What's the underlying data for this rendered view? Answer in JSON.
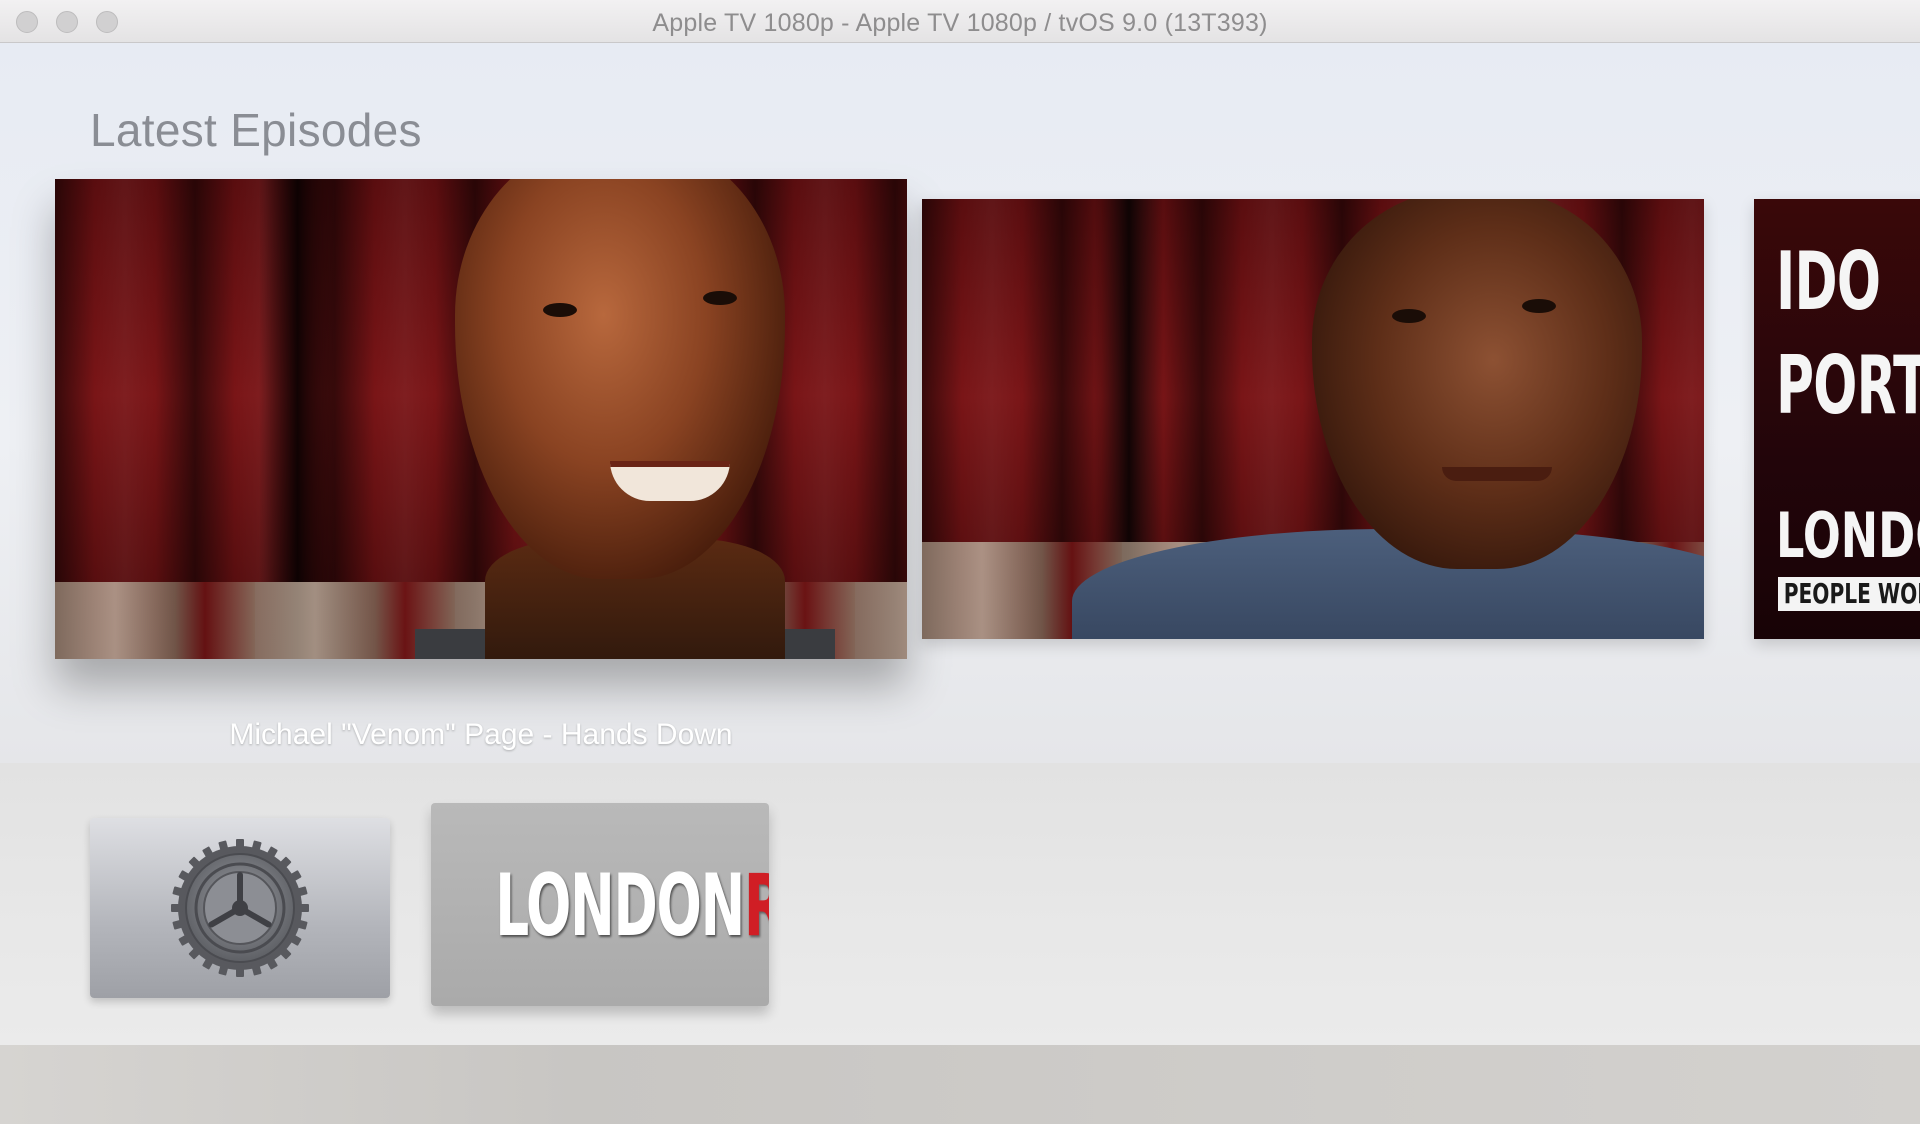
{
  "window": {
    "title": "Apple TV 1080p - Apple TV 1080p / tvOS 9.0 (13T393)"
  },
  "top_shelf": {
    "section_title": "Latest Episodes",
    "episodes": [
      {
        "caption": "Michael \"Venom\" Page - Hands Down",
        "focused": true
      },
      {
        "caption": "",
        "focused": false
      },
      {
        "caption": "",
        "focused": false,
        "poster_lines": [
          "IDO",
          "PORT"
        ],
        "brand": "LONDO",
        "tagline": "PEOPLE WORT"
      }
    ]
  },
  "apps": [
    {
      "name": "Settings",
      "icon": "gear-icon"
    },
    {
      "name": "London Real",
      "logo_part_1": "LONDON",
      "logo_part_2": "REAL"
    }
  ],
  "colors": {
    "logo_red": "#d01e25",
    "section_title": "#8a8d94",
    "caption": "#ffffff"
  }
}
